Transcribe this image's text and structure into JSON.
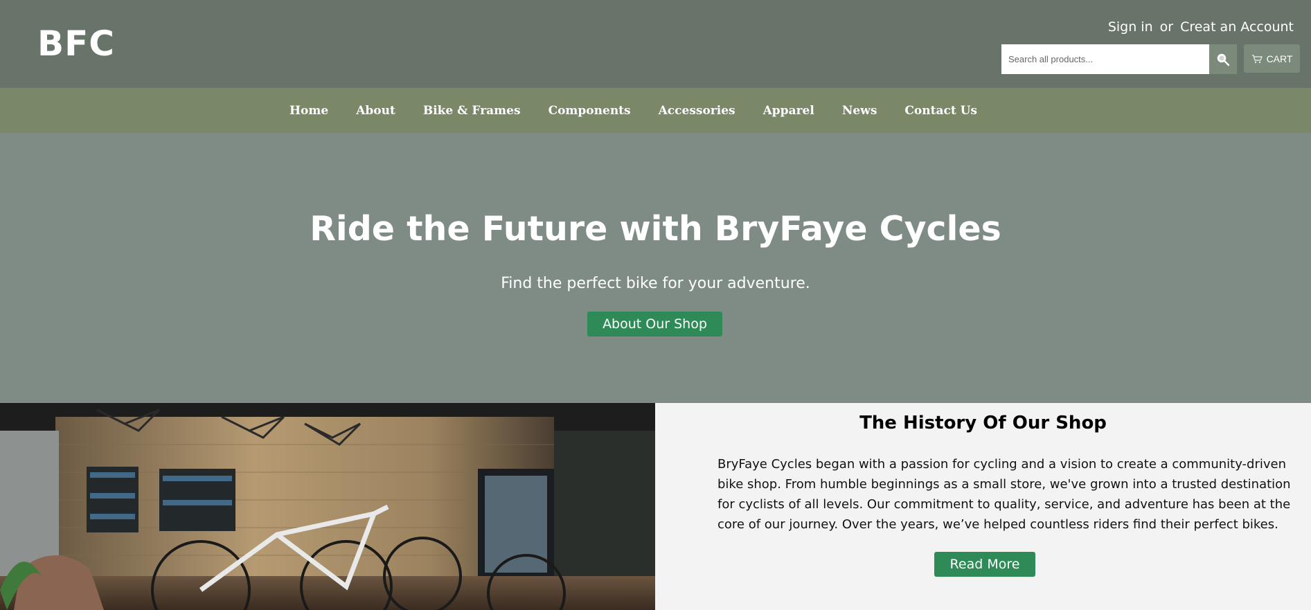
{
  "header": {
    "logo": "BFC",
    "sign_in": "Sign in",
    "or": "or",
    "create_account": "Creat an Account",
    "search_placeholder": "Search all products...",
    "cart_label": "CART"
  },
  "nav": {
    "items": [
      {
        "label": "Home"
      },
      {
        "label": "About"
      },
      {
        "label": "Bike & Frames"
      },
      {
        "label": "Components"
      },
      {
        "label": "Accessories"
      },
      {
        "label": "Apparel"
      },
      {
        "label": "News"
      },
      {
        "label": "Contact Us"
      }
    ]
  },
  "hero": {
    "title": "Ride the Future with BryFaye Cycles",
    "subtitle": "Find the perfect bike for your adventure.",
    "button": "About Our Shop"
  },
  "history": {
    "title": "The History Of Our Shop",
    "text": "BryFaye Cycles began with a passion for cycling and a vision to create a community-driven bike shop. From humble beginnings as a small store, we've grown into a trusted destination for cyclists of all levels. Our commitment to quality, service, and adventure has been at the core of our journey. Over the years, we’ve helped countless riders find their perfect bikes.",
    "button": "Read More"
  },
  "colors": {
    "header_bg": "#68736a",
    "nav_bg": "#7a8868",
    "hero_bg": "#7f8c86",
    "button_green": "#2e8b57",
    "section_bg": "#f3f3f3"
  },
  "icons": {
    "search": "search-icon",
    "cart": "cart-icon"
  }
}
